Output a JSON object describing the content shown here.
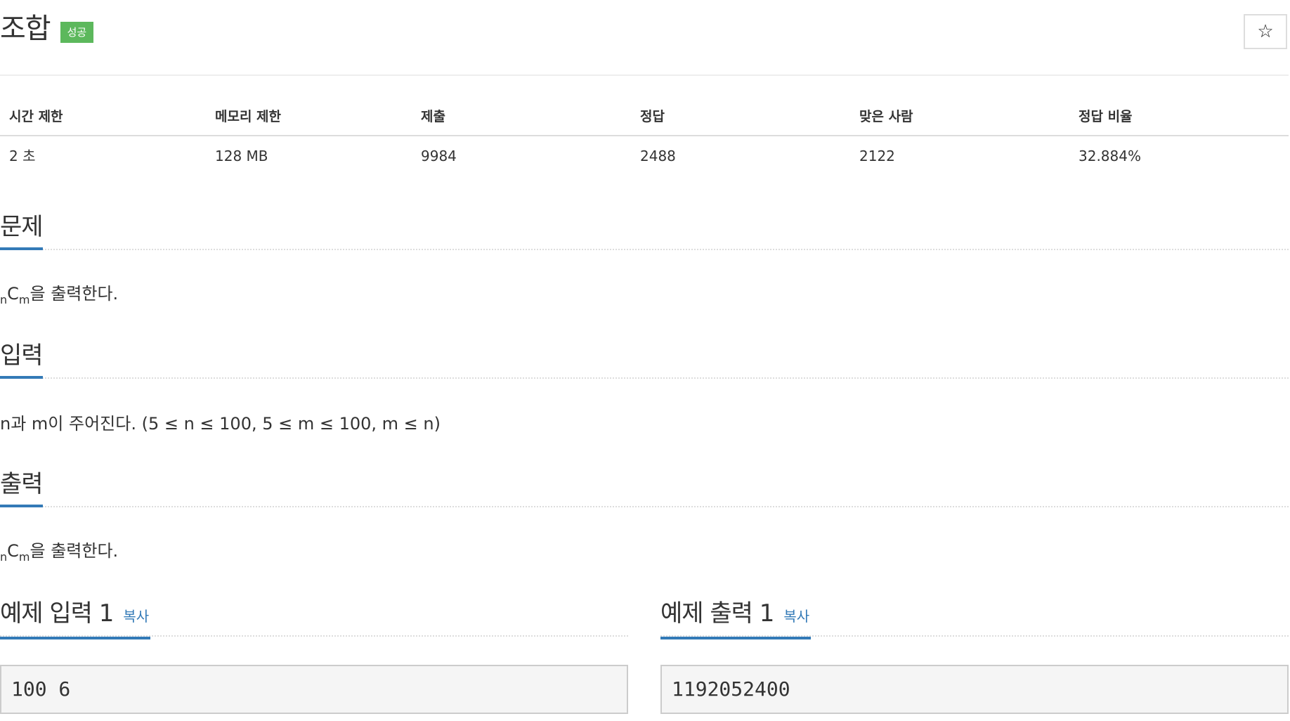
{
  "header": {
    "title": "조합",
    "badge": "성공",
    "star_icon": "☆"
  },
  "info": {
    "headers": [
      "시간 제한",
      "메모리 제한",
      "제출",
      "정답",
      "맞은 사람",
      "정답 비율"
    ],
    "values": [
      "2 초",
      "128 MB",
      "9984",
      "2488",
      "2122",
      "32.884%"
    ]
  },
  "problem": {
    "title": "문제",
    "sub_n": "n",
    "c": "C",
    "sub_m": "m",
    "rest": "을 출력한다."
  },
  "input": {
    "title": "입력",
    "text": "n과 m이 주어진다. (5 ≤ n ≤ 100, 5 ≤ m ≤ 100, m ≤ n)"
  },
  "output": {
    "title": "출력",
    "sub_n": "n",
    "c": "C",
    "sub_m": "m",
    "rest": "을 출력한다."
  },
  "sample_input": {
    "title": "예제 입력 1",
    "copy_label": "복사",
    "value": "100 6"
  },
  "sample_output": {
    "title": "예제 출력 1",
    "copy_label": "복사",
    "value": "1192052400"
  },
  "colors": {
    "accent": "#337ab7",
    "success": "#5cb85c"
  }
}
